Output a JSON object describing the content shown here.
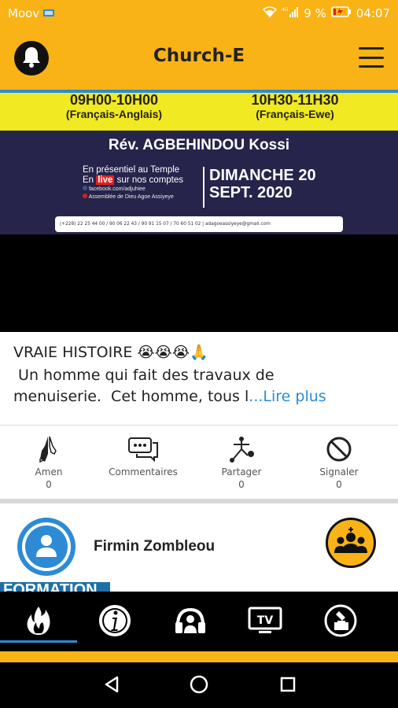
{
  "status_bar": {
    "carrier": "Moov",
    "battery": "9 %",
    "time": "04:07",
    "network": "4G"
  },
  "app_bar": {
    "title": "Church-E"
  },
  "banner": {
    "time1": "09H00-10H00",
    "lang1": "(Français-Anglais)",
    "time2": "10H30-11H30",
    "lang2": "(Français-Ewe)",
    "reverend": "Rév. AGBEHINDOU Kossi",
    "presence_line1": "En présentiel au Temple",
    "presence_line2_a": "En ",
    "presence_live": "live",
    "presence_line2_b": " sur nos comptes",
    "facebook": "facebook.com/adjuhiee",
    "youtube": "Assemblée de Dieu Agoe Assiyeye",
    "date_line1": "DIMANCHE 20",
    "date_line2": "SEPT.  2020",
    "contact": "(+228) 22 25 44 00 / 90 06 22 43 / 90 91 15 07 / 70 60 51 02 | adagoeassiyeye@gmail.com"
  },
  "post": {
    "title": "VRAIE HISTOIRE 😭😭😭🙏",
    "excerpt": " Un homme qui fait des travaux de\nmenuiserie.  Cet homme, tous l",
    "read_more": "...Lire plus"
  },
  "actions": [
    {
      "label": "Amen",
      "count": "0",
      "icon": "praying-hands-icon"
    },
    {
      "label": "Commentaires",
      "count": "",
      "icon": "comments-icon"
    },
    {
      "label": "Partager",
      "count": "0",
      "icon": "share-icon"
    },
    {
      "label": "Signaler",
      "count": "0",
      "icon": "report-icon"
    }
  ],
  "user": {
    "name": "Firmin Zombleou"
  },
  "partial_label": "FORMATION",
  "bottom_nav": [
    {
      "icon": "flame-icon",
      "active": true
    },
    {
      "icon": "info-icon"
    },
    {
      "icon": "headphones-icon"
    },
    {
      "icon": "tv-icon"
    },
    {
      "icon": "donation-icon"
    }
  ],
  "colors": {
    "accent": "#f9b316",
    "blue": "#2d8bd6",
    "banner_bg": "#26244a",
    "banner_yellow": "#f1e922"
  }
}
